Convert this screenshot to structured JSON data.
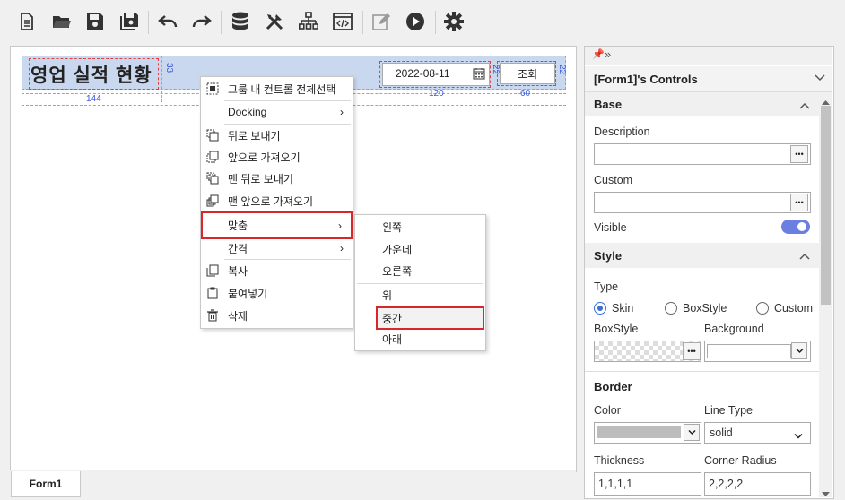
{
  "toolbar": {
    "icons": [
      "new-file-icon",
      "open-folder-icon",
      "save-icon",
      "save-all-icon",
      "undo-icon",
      "redo-icon",
      "database-icon",
      "tools-icon",
      "hierarchy-icon",
      "code-view-icon",
      "edit-icon",
      "run-icon",
      "settings-icon"
    ]
  },
  "form": {
    "title": "영업 실적 현황",
    "date_value": "2022-08-11",
    "search_button": "조회",
    "dims": {
      "title_width": "144",
      "title_height": "33",
      "date_width": "120",
      "button_width": "60",
      "small_a": "22",
      "small_b": "22"
    }
  },
  "tab": {
    "label": "Form1"
  },
  "context_menu": {
    "items": [
      "그룹 내 컨트롤 전체선택",
      "Docking",
      "뒤로 보내기",
      "앞으로 가져오기",
      "맨 뒤로 보내기",
      "맨 앞으로 가져오기",
      "맞춤",
      "간격",
      "복사",
      "붙여넣기",
      "삭제"
    ]
  },
  "submenu": {
    "items": [
      "왼쪽",
      "가운데",
      "오른쪽",
      "위",
      "중간",
      "아래"
    ]
  },
  "panel": {
    "header": "[Form1]'s Controls",
    "base_section": "Base",
    "description_label": "Description",
    "custom_label": "Custom",
    "visible_label": "Visible",
    "style_section": "Style",
    "type_label": "Type",
    "type_options": [
      "Skin",
      "BoxStyle",
      "Custom"
    ],
    "type_selected": "Skin",
    "boxstyle_label": "BoxStyle",
    "background_label": "Background",
    "border_section": "Border",
    "color_label": "Color",
    "linetype_label": "Line Type",
    "linetype_value": "solid",
    "thickness_label": "Thickness",
    "thickness_value": "1,1,1,1",
    "radius_label": "Corner Radius",
    "radius_value": "2,2,2,2",
    "colors": {
      "toggle": "#6b7fe0",
      "highlight": "#d8262a",
      "band": "#c9d7ef"
    }
  }
}
